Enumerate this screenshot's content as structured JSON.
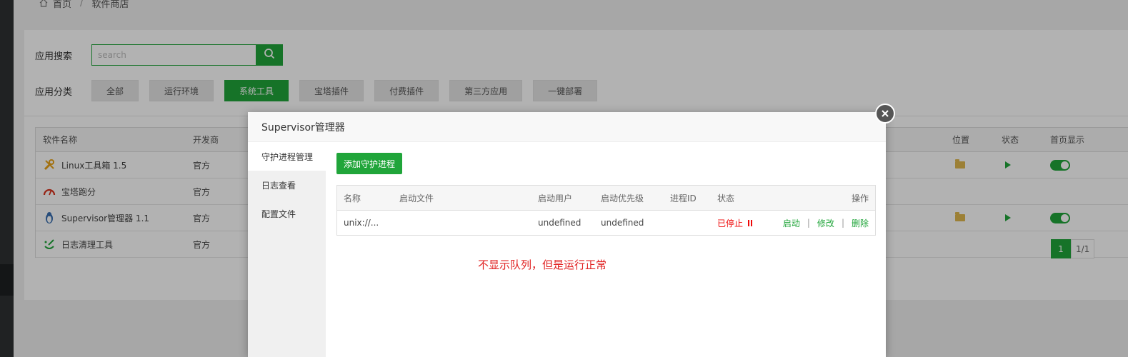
{
  "breadcrumb": {
    "home": "首页",
    "separator": "/",
    "current": "软件商店"
  },
  "search": {
    "label": "应用搜索",
    "placeholder": "search",
    "button_icon": "search-icon"
  },
  "categories": {
    "label": "应用分类",
    "items": [
      "全部",
      "运行环境",
      "系统工具",
      "宝塔插件",
      "付费插件",
      "第三方应用",
      "一键部署"
    ],
    "active_index": 2
  },
  "software_table": {
    "columns": {
      "name": "软件名称",
      "developer": "开发商",
      "location": "位置",
      "status": "状态",
      "homepage": "首页显示"
    },
    "rows": [
      {
        "name": "Linux工具箱 1.5",
        "developer": "官方",
        "icon": "tools-icon",
        "has_actions": true,
        "homepage_on": true
      },
      {
        "name": "宝塔跑分",
        "developer": "官方",
        "icon": "gauge-icon",
        "has_actions": false
      },
      {
        "name": "Supervisor管理器 1.1",
        "developer": "官方",
        "icon": "penguin-icon",
        "has_actions": true,
        "homepage_on": true
      },
      {
        "name": "日志清理工具",
        "developer": "官方",
        "icon": "broom-icon",
        "has_actions": false
      }
    ]
  },
  "pagination": {
    "current": "1",
    "total": "1/1"
  },
  "modal": {
    "title": "Supervisor管理器",
    "sidebar": [
      "守护进程管理",
      "日志查看",
      "配置文件"
    ],
    "active_tab": 0,
    "add_button": "添加守护进程",
    "columns": {
      "name": "名称",
      "file": "启动文件",
      "user": "启动用户",
      "priority": "启动优先级",
      "pid": "进程ID",
      "state": "状态",
      "ops": "操作"
    },
    "row": {
      "name": "unix://...",
      "file": "",
      "user": "undefined",
      "priority": "undefined",
      "pid": "",
      "state": "已停止",
      "ops": [
        "启动",
        "修改",
        "删除"
      ]
    }
  },
  "annotation": "不显示队列，但是运行正常",
  "colors": {
    "accent": "#20a53a",
    "stopped": "#ef0808",
    "annotation": "#e02020"
  }
}
